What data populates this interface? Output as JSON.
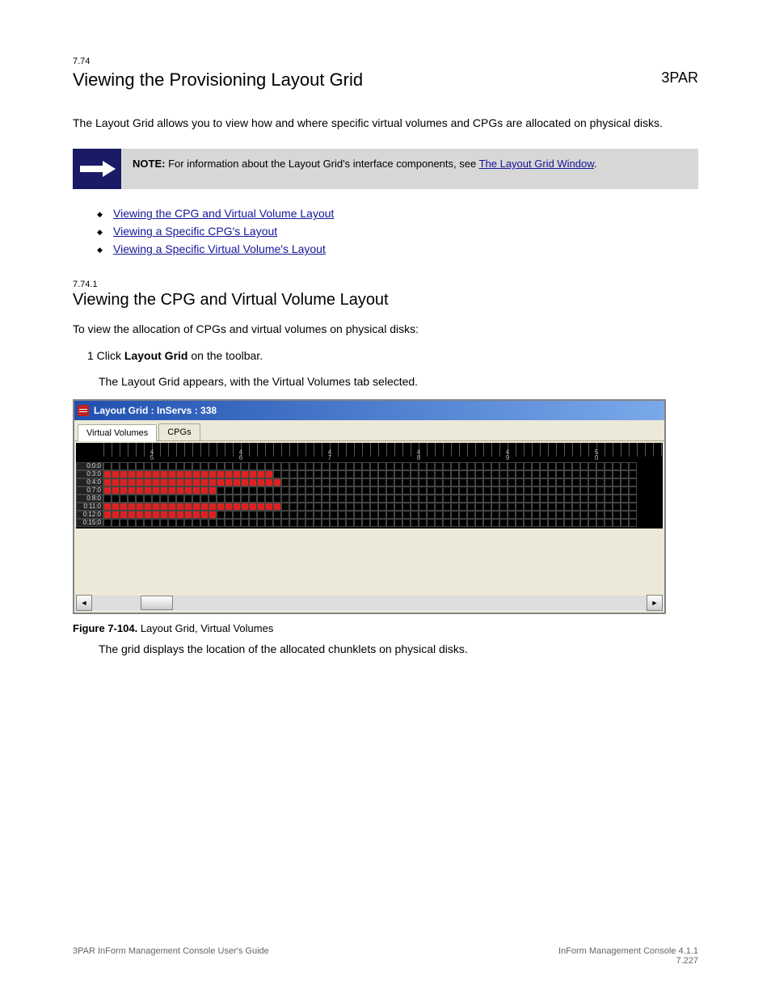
{
  "header": {
    "section_number": "7.74",
    "page_title": "Viewing the Provisioning Layout Grid",
    "brand": "3PAR"
  },
  "intro_para": "The Layout Grid allows you to view how and where specific virtual volumes and CPGs are allocated on physical disks.",
  "note": {
    "label": "NOTE:",
    "body_pre": " For information about the Layout Grid's interface components, see ",
    "link_text": "The Layout Grid Window",
    "body_post": "."
  },
  "toc": [
    "Viewing the CPG and Virtual Volume Layout",
    "Viewing a Specific CPG's Layout",
    "Viewing a Specific Virtual Volume's Layout"
  ],
  "sub": {
    "section_number": "7.74.1",
    "title": "Viewing the CPG and Virtual Volume Layout",
    "para1": "To view the allocation of CPGs and virtual volumes on physical disks:",
    "step1_pre": "1 Click ",
    "step1_strong": "Layout Grid",
    "step1_post": " on the toolbar.",
    "step2": "The Layout Grid appears, with the Virtual Volumes tab selected."
  },
  "gridwin": {
    "title": "Layout Grid : InServs : 338",
    "tabs": [
      "Virtual Volumes",
      "CPGs"
    ],
    "ruler_labels": [
      {
        "top": "4",
        "bot": "5",
        "pos": 90
      },
      {
        "top": "4",
        "bot": "6",
        "pos": 200
      },
      {
        "top": "4",
        "bot": "7",
        "pos": 310
      },
      {
        "top": "4",
        "bot": "8",
        "pos": 420
      },
      {
        "top": "4",
        "bot": "9",
        "pos": 530
      },
      {
        "top": "5",
        "bot": "0",
        "pos": 640
      }
    ],
    "rows": [
      {
        "label": "0:0:0",
        "filled": 0
      },
      {
        "label": "0:3:0",
        "filled": 21
      },
      {
        "label": "0:4:0",
        "filled": 22
      },
      {
        "label": "0:7:0",
        "filled": 14
      },
      {
        "label": "0:8:0",
        "filled": 0
      },
      {
        "label": "0:11:0",
        "filled": 22
      },
      {
        "label": "0:12:0",
        "filled": 14
      },
      {
        "label": "0:15:0",
        "filled": 0
      }
    ],
    "cells_per_row": 66
  },
  "figure": {
    "num": "Figure 7-104.",
    "text": "  Layout Grid, Virtual Volumes"
  },
  "post_para": "The grid displays the location of the allocated chunklets on physical disks.",
  "footer": {
    "doc": "3PAR InForm Management Console User's Guide",
    "right": "InForm Management Console 4.1.1\n7.227"
  }
}
